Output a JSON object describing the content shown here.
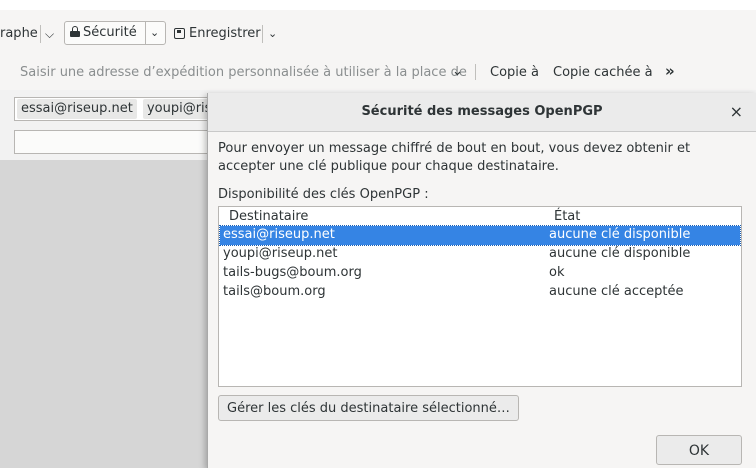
{
  "toolbar": {
    "spell_label": "raphe",
    "security_label": "Sécurité",
    "save_label": "Enregistrer"
  },
  "from_row": {
    "placeholder": "Saisir une adresse d’expédition personnalisée à utiliser à la place de",
    "cc_label": "Copie à",
    "bcc_label": "Copie cachée à",
    "more_label": "»"
  },
  "to_row": {
    "recipients": [
      "essai@riseup.net",
      "youpi@ris"
    ]
  },
  "dialog": {
    "title": "Sécurité des messages OpenPGP",
    "close_symbol": "×",
    "description": "Pour envoyer un message chiffré de bout en bout, vous devez obtenir et accepter une clé publique pour chaque destinataire.",
    "availability_label": "Disponibilité des clés OpenPGP :",
    "columns": {
      "recipient": "Destinataire",
      "status": "État"
    },
    "rows": [
      {
        "recipient": "essai@riseup.net",
        "status": "aucune clé disponible",
        "selected": true
      },
      {
        "recipient": "youpi@riseup.net",
        "status": "aucune clé disponible",
        "selected": false
      },
      {
        "recipient": "tails-bugs@boum.org",
        "status": "ok",
        "selected": false
      },
      {
        "recipient": "tails@boum.org",
        "status": "aucune clé acceptée",
        "selected": false
      }
    ],
    "manage_button": "Gérer les clés du destinataire sélectionné…",
    "ok_button": "OK"
  },
  "colors": {
    "selection": "#3584e4"
  }
}
